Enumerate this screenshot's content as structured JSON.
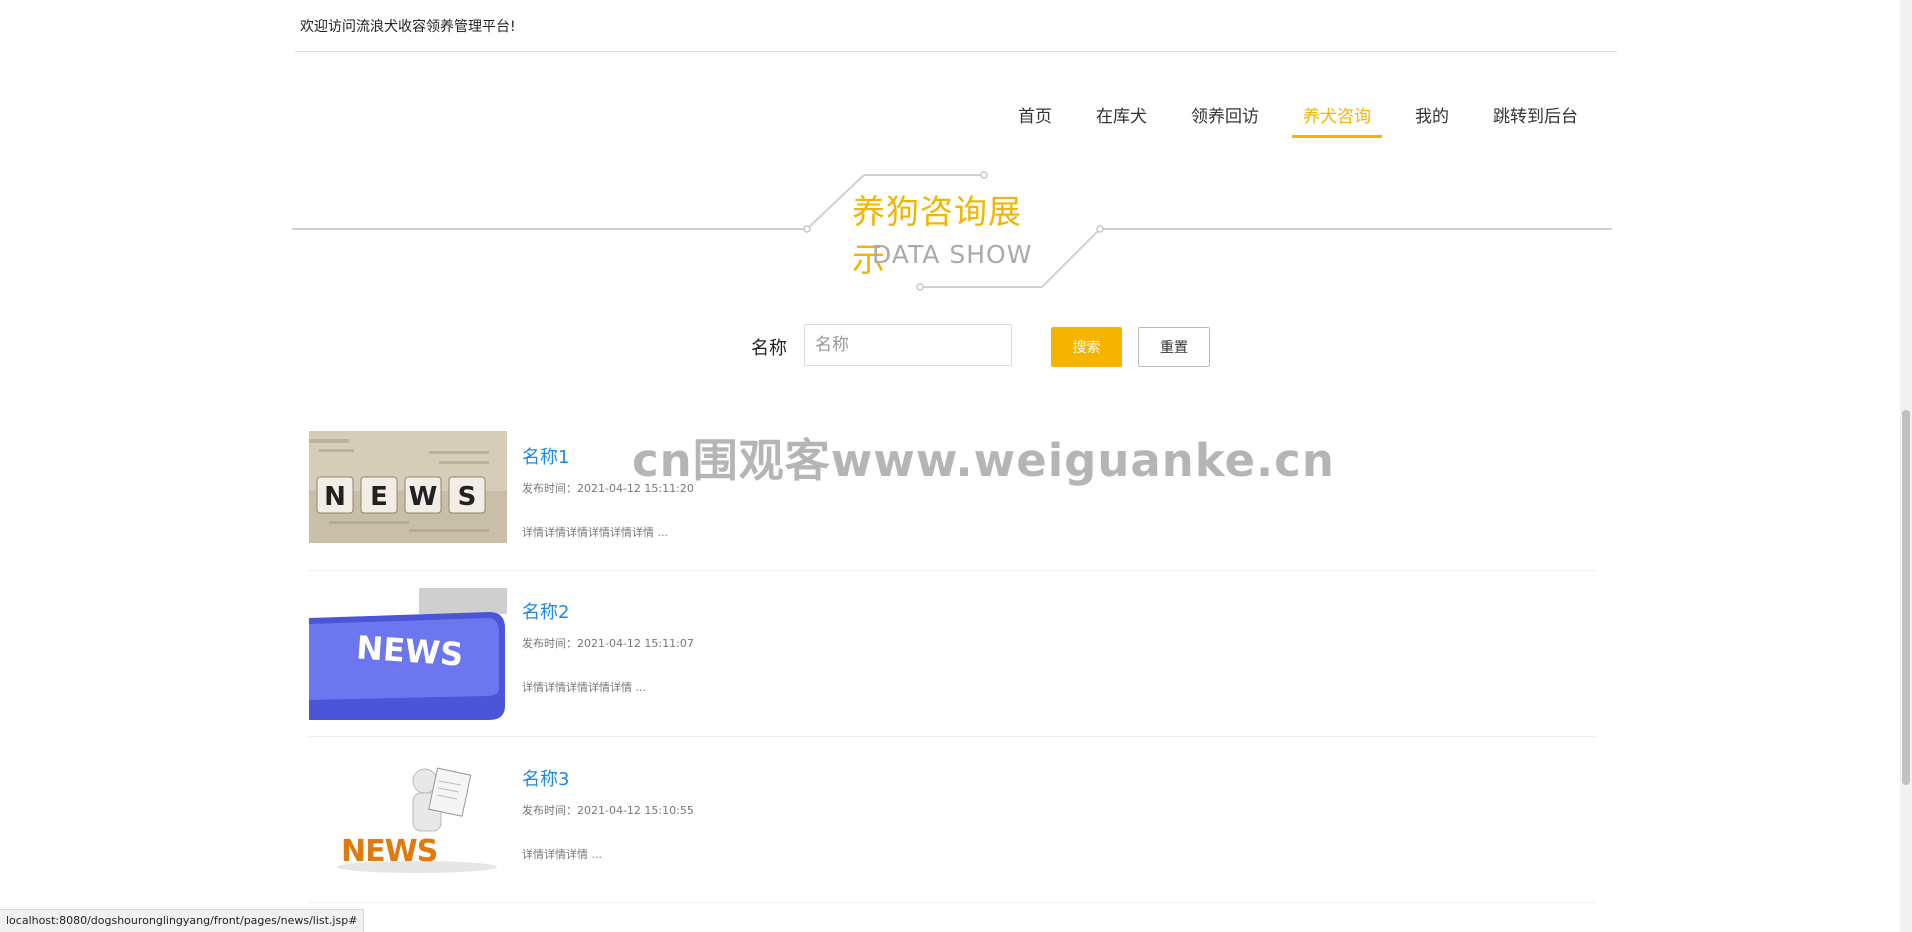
{
  "header": {
    "welcome": "欢迎访问流浪犬收容领养管理平台!"
  },
  "nav": {
    "items": [
      {
        "label": "首页",
        "active": false
      },
      {
        "label": "在库犬",
        "active": false
      },
      {
        "label": "领养回访",
        "active": false
      },
      {
        "label": "养犬咨询",
        "active": true
      },
      {
        "label": "我的",
        "active": false
      },
      {
        "label": "跳转到后台",
        "active": false
      }
    ]
  },
  "section": {
    "title_cn": "养狗咨询展示",
    "title_en": "DATA SHOW"
  },
  "search": {
    "label": "名称",
    "placeholder": "名称",
    "value": "",
    "search_label": "搜索",
    "reset_label": "重置"
  },
  "news": [
    {
      "title": "名称1",
      "time": "发布时间：2021-04-12 15:11:20",
      "desc": "详情详情详情详情详情详情 ..."
    },
    {
      "title": "名称2",
      "time": "发布时间：2021-04-12 15:11:07",
      "desc": "详情详情详情详情详情 ..."
    },
    {
      "title": "名称3",
      "time": "发布时间：2021-04-12 15:10:55",
      "desc": "详情详情详情 ..."
    }
  ],
  "watermark": "cn围观客www.weiguanke.cn",
  "status_bar": {
    "url": "localhost:8080/dogshouronglingyang/front/pages/news/list.jsp#"
  },
  "colors": {
    "accent": "#f5b400",
    "link": "#1e88e5"
  }
}
